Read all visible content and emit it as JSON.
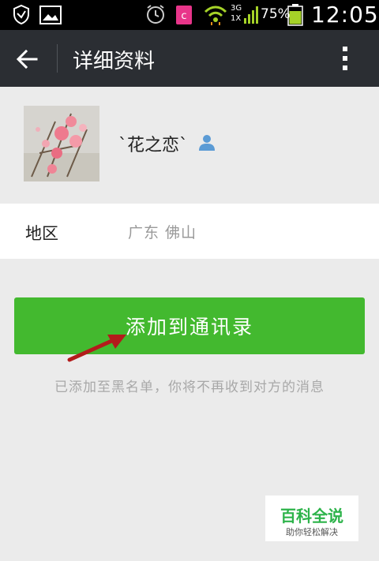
{
  "status_bar": {
    "battery_percent": "75%",
    "network_top": "3G",
    "network_bottom": "1X",
    "time": "12:05",
    "icons": [
      "shield-icon",
      "gallery-icon",
      "alarm-icon",
      "app-icon",
      "wifi-icon",
      "signal-icon",
      "battery-icon"
    ]
  },
  "header": {
    "title": "详细资料",
    "back_icon": "back-arrow-icon",
    "more_icon": "more-vertical-icon"
  },
  "profile": {
    "nickname": "`花之恋`",
    "badge_icon": "contact-person-icon"
  },
  "region": {
    "label": "地区",
    "value": "广东  佛山"
  },
  "actions": {
    "add_contact_label": "添加到通讯录"
  },
  "notice": "已添加至黑名单，你将不再收到对方的消息",
  "watermark": {
    "title": "百科全说",
    "subtitle": "助你轻松解决"
  },
  "colors": {
    "accent_green": "#43b92f",
    "title_bar": "#2b2e33",
    "arrow_red": "#b31b1b"
  }
}
